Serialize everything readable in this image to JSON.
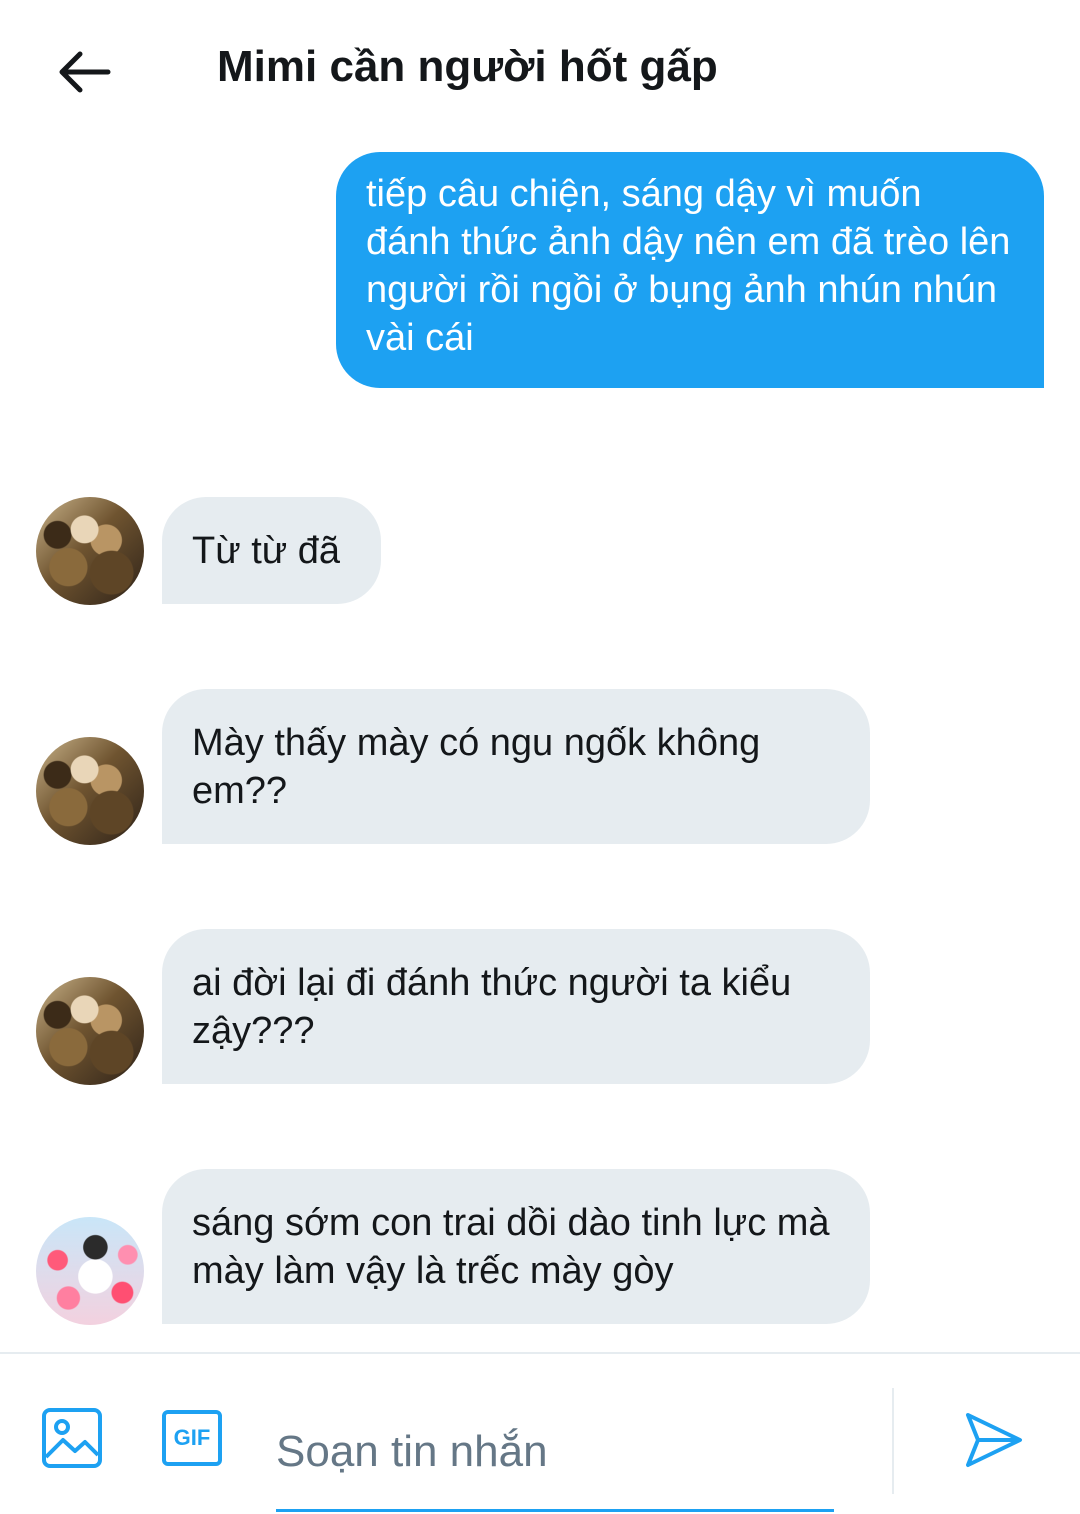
{
  "header": {
    "title": "Mimi cần người hốt gấp",
    "back_icon": "arrow-left-icon"
  },
  "messages": [
    {
      "direction": "sent",
      "text": "tiếp câu chiện, sáng dậy vì muốn đánh thức ảnh dậy nên em đã trèo lên người rồi ngồi ở bụng ảnh nhún nhún vài cái"
    },
    {
      "direction": "received",
      "avatar": "fur-coat-avatar",
      "text": "Từ từ đã"
    },
    {
      "direction": "received",
      "avatar": "fur-coat-avatar",
      "text": "Mày thấy mày có ngu ngốk không em??"
    },
    {
      "direction": "received",
      "avatar": "fur-coat-avatar",
      "text": "ai đời lại đi đánh thức người ta kiểu zậy???"
    },
    {
      "direction": "received",
      "avatar": "hearts-avatar",
      "text": "sáng sớm con trai dồi dào tinh lực mà mày làm vậy là trếc mày gòy"
    }
  ],
  "composer": {
    "placeholder": "Soạn tin nhắn",
    "value": "",
    "media_icon": "image-icon",
    "gif_label": "GIF",
    "send_icon": "send-icon"
  },
  "colors": {
    "accent": "#1da1f2",
    "received_bubble": "#e6ecf0",
    "text": "#14171a",
    "placeholder": "#657786"
  }
}
